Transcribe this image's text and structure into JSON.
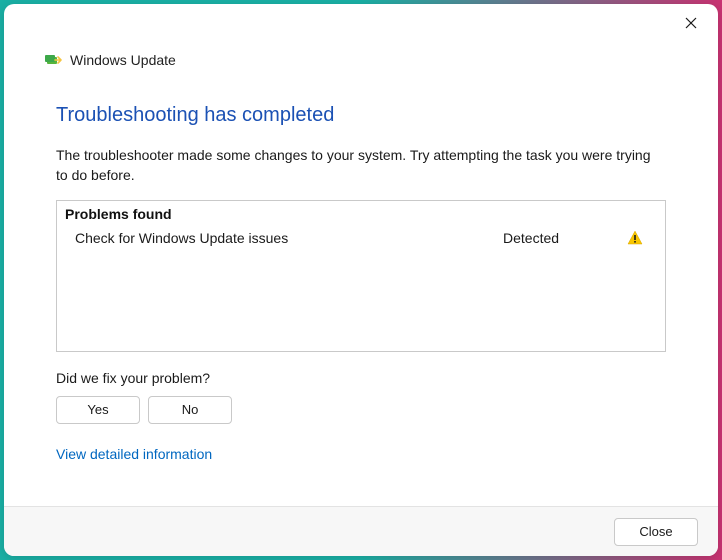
{
  "header": {
    "title": "Windows Update"
  },
  "main": {
    "heading": "Troubleshooting has completed",
    "subtext": "The troubleshooter made some changes to your system. Try attempting the task you were trying to do before.",
    "problems_header": "Problems found",
    "problems": [
      {
        "label": "Check for Windows Update issues",
        "status": "Detected"
      }
    ],
    "feedback_prompt": "Did we fix your problem?",
    "yes_label": "Yes",
    "no_label": "No",
    "detailed_link": "View detailed information"
  },
  "footer": {
    "close_label": "Close"
  }
}
